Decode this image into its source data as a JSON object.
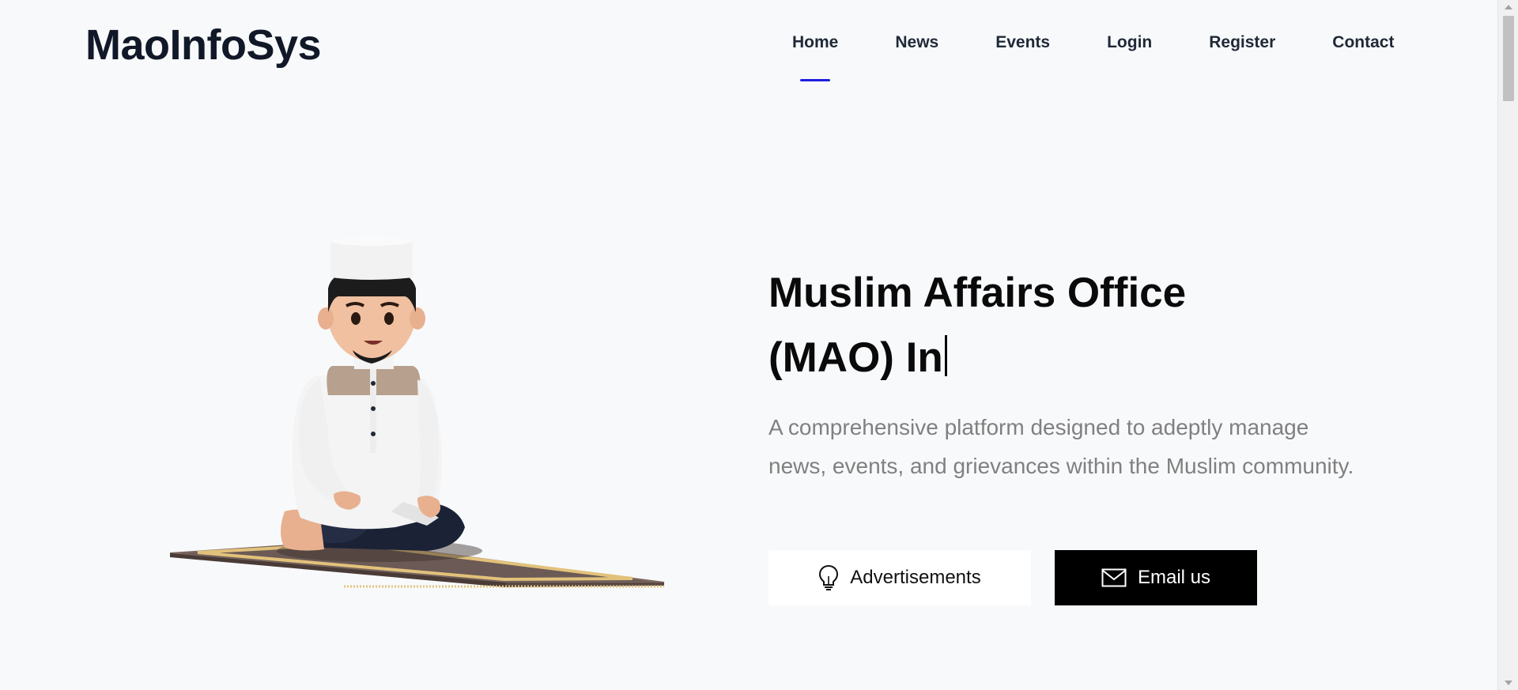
{
  "header": {
    "brand": "MaoInfoSys",
    "nav": [
      {
        "label": "Home",
        "active": true
      },
      {
        "label": "News",
        "active": false
      },
      {
        "label": "Events",
        "active": false
      },
      {
        "label": "Login",
        "active": false
      },
      {
        "label": "Register",
        "active": false
      },
      {
        "label": "Contact",
        "active": false
      }
    ],
    "active_indicator_color": "#1d1de0"
  },
  "hero": {
    "title_line1": "Muslim Affairs Office",
    "title_line2": "(MAO) In",
    "description_line1": "A comprehensive platform designed to adeptly manage",
    "description_line2": "news, events, and grievances within the Muslim community.",
    "buttons": {
      "advertisements": {
        "label": "Advertisements",
        "icon": "lightbulb-icon"
      },
      "email": {
        "label": "Email us",
        "icon": "envelope-icon"
      }
    },
    "illustration": "man-praying-on-rug-illustration"
  },
  "colors": {
    "background": "#f8f9fb",
    "text_dark": "#111827",
    "description_gray": "#808080",
    "email_button_bg": "#000000",
    "ads_button_bg": "#ffffff"
  }
}
